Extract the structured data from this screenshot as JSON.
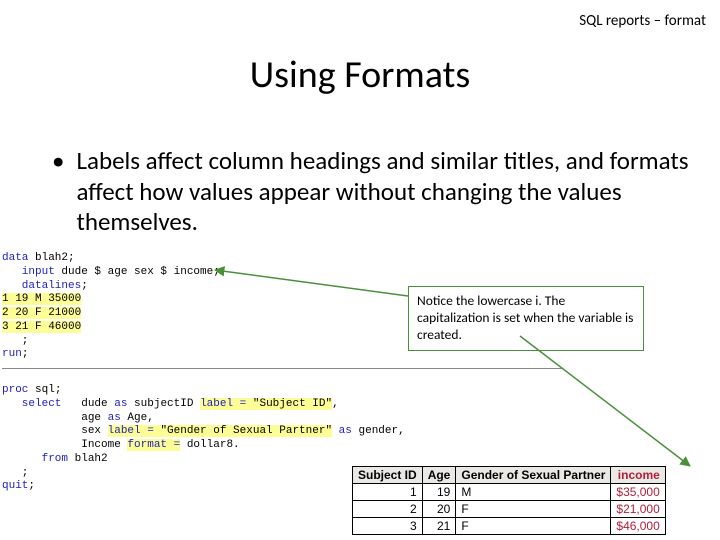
{
  "header": {
    "path": "SQL reports – format"
  },
  "title": "Using Formats",
  "bullet": {
    "marker": "•",
    "text": "Labels affect column headings and similar titles, and formats affect how values appear without changing the values themselves."
  },
  "code": {
    "l1": {
      "a": "data",
      "b": " blah2;"
    },
    "l2": {
      "a": "   input",
      "b": " dude $ age sex $ income;"
    },
    "l3": {
      "a": "   datalines",
      "b": ";"
    },
    "l4": "1 19 M 35000",
    "l5": "2 20 F 21000",
    "l6": "3 21 F 46000",
    "l7": "   ;",
    "l8": {
      "a": "run",
      "b": ";"
    },
    "l9": {
      "a": "proc ",
      "b": "sql",
      "c": ";"
    },
    "l10": {
      "a": "   select",
      "b": "   dude ",
      "c": "as",
      "d": " subjectID ",
      "e": "label = ",
      "f": "\"Subject ID\"",
      "g": ","
    },
    "l11": {
      "a": "            age ",
      "b": "as",
      "c": " Age,"
    },
    "l12": {
      "a": "            sex ",
      "b": "label = ",
      "c": "\"Gender of Sexual Partner\"",
      "d": " as",
      "e": " gender,"
    },
    "l13": {
      "a": "            Income ",
      "b": "format =",
      "c": " dollar8."
    },
    "l14": {
      "a": "      from",
      "b": " blah2"
    },
    "l15": "   ;",
    "l16": {
      "a": "quit",
      "b": ";"
    }
  },
  "callout": {
    "text": "Notice the lowercase i.  The capitalization is set when the variable is created."
  },
  "table": {
    "headers": {
      "c1": "Subject ID",
      "c2": "Age",
      "c3": "Gender of Sexual Partner",
      "c4": "income"
    },
    "rows": [
      {
        "c1": "1",
        "c2": "19",
        "c3": "M",
        "c4": "$35,000"
      },
      {
        "c1": "2",
        "c2": "20",
        "c3": "F",
        "c4": "$21,000"
      },
      {
        "c1": "3",
        "c2": "21",
        "c3": "F",
        "c4": "$46,000"
      }
    ]
  }
}
